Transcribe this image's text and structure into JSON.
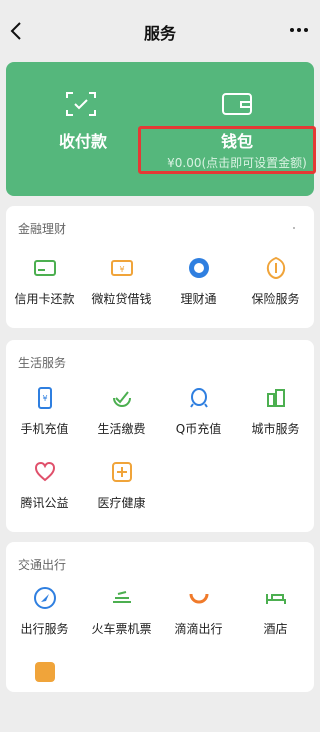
{
  "header": {
    "title": "服务"
  },
  "wallet_panel": {
    "collect_label": "收付款",
    "wallet_label": "钱包",
    "wallet_balance_text": "¥0.00(点击即可设置金额)"
  },
  "sections": {
    "finance": {
      "title": "金融理财",
      "items": [
        {
          "label": "信用卡还款",
          "icon": "credit-card-icon"
        },
        {
          "label": "微粒贷借钱",
          "icon": "loan-icon"
        },
        {
          "label": "理财通",
          "icon": "wealth-icon"
        },
        {
          "label": "保险服务",
          "icon": "insurance-icon"
        }
      ]
    },
    "life": {
      "title": "生活服务",
      "items": [
        {
          "label": "手机充值",
          "icon": "phone-recharge-icon"
        },
        {
          "label": "生活缴费",
          "icon": "utility-bill-icon"
        },
        {
          "label": "Q币充值",
          "icon": "qq-coin-icon"
        },
        {
          "label": "城市服务",
          "icon": "city-service-icon"
        },
        {
          "label": "腾讯公益",
          "icon": "charity-icon"
        },
        {
          "label": "医疗健康",
          "icon": "medical-icon"
        }
      ]
    },
    "transport": {
      "title": "交通出行",
      "items": [
        {
          "label": "出行服务",
          "icon": "travel-service-icon"
        },
        {
          "label": "火车票机票",
          "icon": "train-ticket-icon"
        },
        {
          "label": "滴滴出行",
          "icon": "didi-icon"
        },
        {
          "label": "酒店",
          "icon": "hotel-icon"
        }
      ]
    }
  },
  "colors": {
    "accent_green": "#55b77c",
    "highlight_red": "#e53935",
    "page_bg": "#ededed"
  }
}
